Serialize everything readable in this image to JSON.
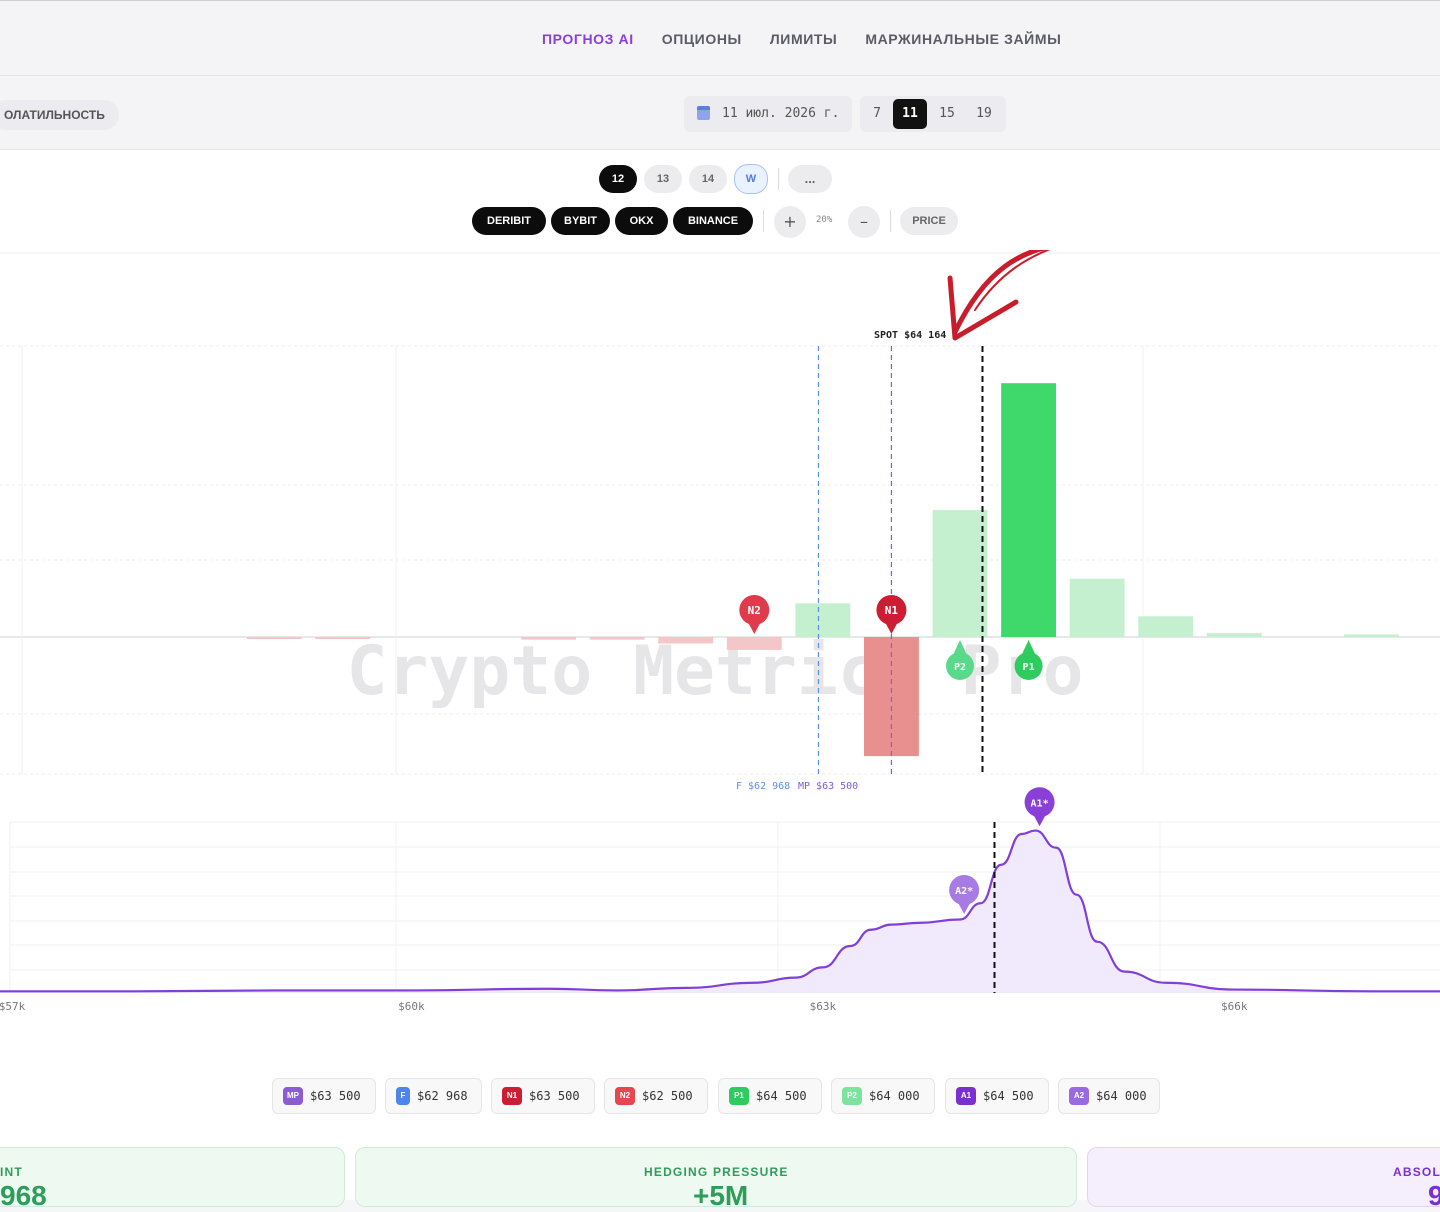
{
  "nav": {
    "tabs": [
      {
        "label": "ПРОГНОЗ AI",
        "active": true
      },
      {
        "label": "ОПЦИОНЫ",
        "active": false
      },
      {
        "label": "ЛИМИТЫ",
        "active": false
      },
      {
        "label": "МАРЖИНАЛЬНЫЕ ЗАЙМЫ",
        "active": false
      }
    ]
  },
  "toolbar": {
    "volatility_label": "ОЛАТИЛЬНОСТЬ",
    "date": "11 июл. 2026 г.",
    "days": [
      "7",
      "11",
      "15",
      "19"
    ],
    "active_day": "11"
  },
  "controls": {
    "hours": [
      "12",
      "13",
      "14",
      "W"
    ],
    "active_hour": "12",
    "more_label": "...",
    "exchanges": [
      "DERIBIT",
      "BYBIT",
      "OKX",
      "BINANCE"
    ],
    "plus_label": "+",
    "minus_label": "–",
    "zoom": "20%",
    "price_label": "PRICE"
  },
  "chart_data": [
    {
      "type": "bar",
      "x_unit": "USD",
      "x": [
        59000,
        59500,
        60000,
        60500,
        61000,
        61500,
        62000,
        62500,
        63000,
        63500,
        64000,
        64500,
        65000,
        65500,
        66000,
        66500,
        67000,
        67500
      ],
      "values": [
        -0.01,
        -0.01,
        0,
        0,
        -0.02,
        -0.02,
        -0.05,
        -0.1,
        0.26,
        -0.92,
        0.98,
        1.96,
        0.45,
        0.16,
        0.03,
        0,
        0.02,
        0
      ],
      "ylim": [
        -1.05,
        2.2
      ],
      "positive_colors": [
        "#c4f0cf",
        "#3fd96b"
      ],
      "negative_colors": [
        "#f3c7c7",
        "#e88f8f"
      ],
      "spot_label": "SPOT $64 164",
      "spot": 64164,
      "lines": [
        {
          "label": "F $62 968",
          "value": 62968,
          "color": "#5b8fe8"
        },
        {
          "label": "MP $63 500",
          "value": 63500,
          "color": "#8b5cd6"
        }
      ],
      "markers": [
        {
          "label": "N2",
          "x": 62500,
          "color": "#e03b4a"
        },
        {
          "label": "N1",
          "x": 63500,
          "color": "#cc1d33"
        },
        {
          "label": "P2",
          "x": 64000,
          "color": "#5ad98a"
        },
        {
          "label": "P1",
          "x": 64500,
          "color": "#2ecc5e"
        }
      ],
      "watermark": "Crypto Metrics Pro"
    },
    {
      "type": "area",
      "x_unit": "USD",
      "x_ticks": [
        "$57k",
        "$60k",
        "$63k",
        "$66k"
      ],
      "x_tick_values": [
        57000,
        60000,
        63000,
        66000
      ],
      "xlim": [
        57000,
        67500
      ],
      "x": [
        57000,
        58000,
        59000,
        60000,
        61000,
        61500,
        62000,
        62500,
        62800,
        63000,
        63200,
        63350,
        63500,
        63700,
        64000,
        64150,
        64300,
        64450,
        64550,
        64700,
        64850,
        65000,
        65200,
        65500,
        66000,
        67000,
        67500
      ],
      "values": [
        0.02,
        0.02,
        0.03,
        0.03,
        0.05,
        0.03,
        0.06,
        0.12,
        0.18,
        0.3,
        0.55,
        0.74,
        0.8,
        0.82,
        0.86,
        1.05,
        1.5,
        1.86,
        1.9,
        1.7,
        1.15,
        0.6,
        0.25,
        0.12,
        0.04,
        0.02,
        0.02
      ],
      "ylim": [
        0,
        2.0
      ],
      "color": "#7f3fd8",
      "spot": 64164,
      "markers": [
        {
          "label": "A1*",
          "x": 64500,
          "color": "#8a3fd6"
        },
        {
          "label": "A2*",
          "x": 63950,
          "color": "#a77ae4"
        }
      ]
    }
  ],
  "legend": [
    {
      "tag": "MP",
      "value": "$63 500",
      "color": "#8b5cd6"
    },
    {
      "tag": "F",
      "value": "$62 968",
      "color": "#4f84e8"
    },
    {
      "tag": "N1",
      "value": "$63 500",
      "color": "#cc1d33"
    },
    {
      "tag": "N2",
      "value": "$62 500",
      "color": "#e4484f"
    },
    {
      "tag": "P1",
      "value": "$64 500",
      "color": "#2ecc5e"
    },
    {
      "tag": "P2",
      "value": "$64 000",
      "color": "#7fe3a0"
    },
    {
      "tag": "A1",
      "value": "$64 500",
      "color": "#7a2fd0"
    },
    {
      "tag": "A2",
      "value": "$64 000",
      "color": "#9a6be0"
    }
  ],
  "cards": [
    {
      "title": "INT",
      "value": "968",
      "color": "#2f9d59"
    },
    {
      "title": "HEDGING PRESSURE",
      "value": "+5M",
      "color": "#2f9d59"
    },
    {
      "title": "ABSOL",
      "value": "9",
      "color": "#7a2fd0"
    }
  ]
}
